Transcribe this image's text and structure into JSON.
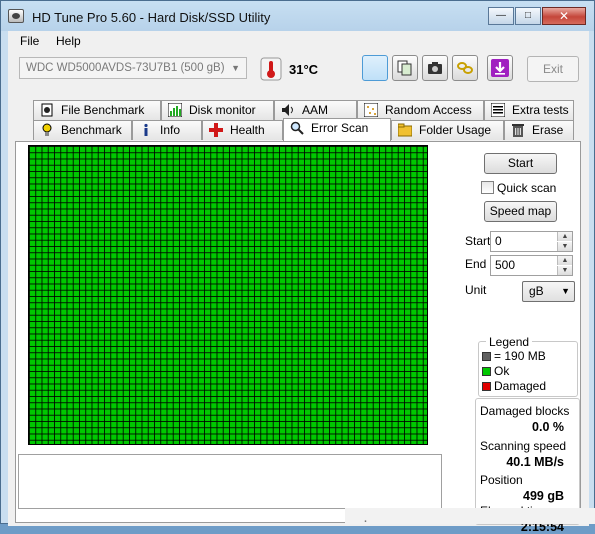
{
  "window": {
    "title": "HD Tune Pro 5.60 - Hard Disk/SSD Utility",
    "minimize": "—",
    "maximize": "□",
    "close": "✕"
  },
  "menu": {
    "file": "File",
    "help": "Help"
  },
  "toolbar": {
    "drive": "WDC WD5000AVDS-73U7B1 (500 gB)",
    "temperature": "31°C",
    "exit": "Exit",
    "icons": [
      "thermometer-icon",
      "blank-icon",
      "copy-icon",
      "camera-icon",
      "chain-icon",
      "download-arrow-icon"
    ]
  },
  "tabs_top": [
    "File Benchmark",
    "Disk monitor",
    "AAM",
    "Random Access",
    "Extra tests"
  ],
  "tabs_bottom": [
    "Benchmark",
    "Info",
    "Health",
    "Error Scan",
    "Folder Usage",
    "Erase"
  ],
  "active_tab": "Error Scan",
  "scan": {
    "start_button": "Start",
    "quick_scan": "Quick scan",
    "quick_scan_checked": false,
    "speed_map": "Speed map",
    "start_label": "Start",
    "start_value": "0",
    "end_label": "End",
    "end_value": "500",
    "unit_label": "Unit",
    "unit_value": "gB",
    "block_status": "ok",
    "blocks_damaged": 0
  },
  "legend": {
    "title": "Legend",
    "block_size": "= 190 MB",
    "ok": "Ok",
    "damaged": "Damaged",
    "colors": {
      "block": "#606060",
      "ok": "#00c800",
      "damaged": "#e00000"
    }
  },
  "stats": {
    "damaged_label": "Damaged blocks",
    "damaged_value": "0.0 %",
    "speed_label": "Scanning speed",
    "speed_value": "40.1 MB/s",
    "position_label": "Position",
    "position_value": "499 gB",
    "elapsed_label": "Elapsed time",
    "elapsed_value": "2:15:54"
  }
}
